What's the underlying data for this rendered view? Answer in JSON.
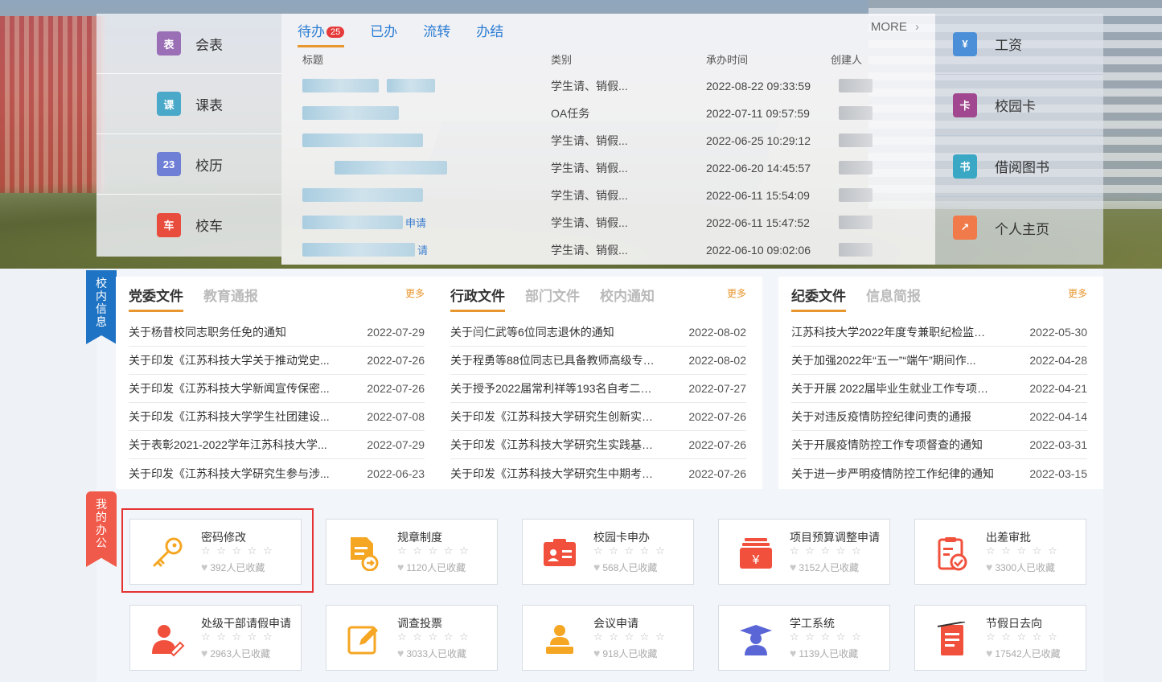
{
  "quick_left": [
    {
      "label": "会表",
      "icon": "report-icon",
      "color": "#9b6fb5",
      "glyph": "表"
    },
    {
      "label": "课表",
      "icon": "timetable-icon",
      "color": "#4aa8c9",
      "glyph": "课"
    },
    {
      "label": "校历",
      "icon": "calendar-icon",
      "color": "#6f7fd6",
      "glyph": "23"
    },
    {
      "label": "校车",
      "icon": "bus-icon",
      "color": "#e84c3d",
      "glyph": "车"
    }
  ],
  "todo": {
    "tabs": [
      {
        "label": "待办",
        "badge": "25"
      },
      {
        "label": "已办"
      },
      {
        "label": "流转"
      },
      {
        "label": "办结"
      }
    ],
    "more": "MORE",
    "more_arrow": "›",
    "headers": {
      "title": "标题",
      "type": "类别",
      "time": "承办时间",
      "creator": "创建人"
    },
    "rows": [
      {
        "title_suffix": "",
        "type": "学生请、销假...",
        "time": "2022-08-22 09:33:59"
      },
      {
        "title_suffix": "",
        "type": "OA任务",
        "time": "2022-07-11 09:57:59"
      },
      {
        "title_suffix": "",
        "type": "学生请、销假...",
        "time": "2022-06-25 10:29:12"
      },
      {
        "title_suffix": "",
        "type": "学生请、销假...",
        "time": "2022-06-20 14:45:57"
      },
      {
        "title_suffix": "",
        "type": "学生请、销假...",
        "time": "2022-06-11 15:54:09"
      },
      {
        "title_suffix": "申请",
        "type": "学生请、销假...",
        "time": "2022-06-11 15:47:52"
      },
      {
        "title_suffix": "请",
        "type": "学生请、销假...",
        "time": "2022-06-10 09:02:06"
      }
    ]
  },
  "quick_right": [
    {
      "label": "工资",
      "icon": "salary-icon",
      "color": "#4a8fd8",
      "glyph": "¥"
    },
    {
      "label": "校园卡",
      "icon": "campus-card-icon",
      "color": "#a0478f",
      "glyph": "卡"
    },
    {
      "label": "借阅图书",
      "icon": "book-icon",
      "color": "#3aa7c4",
      "glyph": "书"
    },
    {
      "label": "个人主页",
      "icon": "chart-line-icon",
      "color": "#f07a4a",
      "glyph": "↗"
    }
  ],
  "ribbons": {
    "info": "校内信息",
    "office": "我的办公"
  },
  "news": [
    {
      "tabs": [
        "党委文件",
        "教育通报"
      ],
      "more": "更多",
      "items": [
        {
          "title": "关于杨昔校同志职务任免的通知",
          "date": "2022-07-29"
        },
        {
          "title": "关于印发《江苏科技大学关于推动党史...",
          "date": "2022-07-26"
        },
        {
          "title": "关于印发《江苏科技大学新闻宣传保密...",
          "date": "2022-07-26"
        },
        {
          "title": "关于印发《江苏科技大学学生社团建设...",
          "date": "2022-07-08"
        },
        {
          "title": "关于表彰2021-2022学年江苏科技大学...",
          "date": "2022-07-29"
        },
        {
          "title": "关于印发《江苏科技大学研究生参与涉...",
          "date": "2022-06-23"
        }
      ]
    },
    {
      "tabs": [
        "行政文件",
        "部门文件",
        "校内通知"
      ],
      "more": "更多",
      "items": [
        {
          "title": "关于闫仁武等6位同志退休的通知",
          "date": "2022-08-02"
        },
        {
          "title": "关于程勇等88位同志已具备教师高级专业...",
          "date": "2022-08-02"
        },
        {
          "title": "关于授予2022届常利祥等193名自考二学...",
          "date": "2022-07-27"
        },
        {
          "title": "关于印发《江苏科技大学研究生创新实践...",
          "date": "2022-07-26"
        },
        {
          "title": "关于印发《江苏科技大学研究生实践基地...",
          "date": "2022-07-26"
        },
        {
          "title": "关于印发《江苏科技大学研究生中期考核...",
          "date": "2022-07-26"
        }
      ]
    },
    {
      "tabs": [
        "纪委文件",
        "信息简报"
      ],
      "more": "更多",
      "items": [
        {
          "title": "江苏科技大学2022年度专兼职纪检监察干...",
          "date": "2022-05-30"
        },
        {
          "title": "关于加强2022年“五一”“端午”期间作...",
          "date": "2022-04-28"
        },
        {
          "title": "关于开展 2022届毕业生就业工作专项督查...",
          "date": "2022-04-21"
        },
        {
          "title": "关于对违反疫情防控纪律问责的通报",
          "date": "2022-04-14"
        },
        {
          "title": "关于开展疫情防控工作专项督查的通知",
          "date": "2022-03-31"
        },
        {
          "title": "关于进一步严明疫情防控工作纪律的通知",
          "date": "2022-03-15"
        }
      ]
    }
  ],
  "apps": [
    {
      "name": "密码修改",
      "icon": "key-icon",
      "color": "#f5a623",
      "stars": "☆ ☆ ☆ ☆ ☆",
      "fav": "392人已收藏"
    },
    {
      "name": "规章制度",
      "icon": "document-arrow-icon",
      "color": "#f5a623",
      "stars": "☆ ☆ ☆ ☆ ☆",
      "fav": "1120人已收藏"
    },
    {
      "name": "校园卡申办",
      "icon": "id-card-icon",
      "color": "#f0503c",
      "stars": "☆ ☆ ☆ ☆ ☆",
      "fav": "568人已收藏"
    },
    {
      "name": "项目预算调整申请",
      "icon": "budget-icon",
      "color": "#f0503c",
      "stars": "☆ ☆ ☆ ☆ ☆",
      "fav": "3152人已收藏"
    },
    {
      "name": "出差审批",
      "icon": "clipboard-check-icon",
      "color": "#f0503c",
      "stars": "☆ ☆ ☆ ☆ ☆",
      "fav": "3300人已收藏"
    },
    {
      "name": "处级干部请假申请",
      "icon": "person-edit-icon",
      "color": "#f0503c",
      "stars": "☆ ☆ ☆ ☆ ☆",
      "fav": "2963人已收藏"
    },
    {
      "name": "调查投票",
      "icon": "survey-edit-icon",
      "color": "#f5a623",
      "stars": "☆ ☆ ☆ ☆ ☆",
      "fav": "3033人已收藏"
    },
    {
      "name": "会议申请",
      "icon": "meeting-icon",
      "color": "#f5a623",
      "stars": "☆ ☆ ☆ ☆ ☆",
      "fav": "918人已收藏"
    },
    {
      "name": "学工系统",
      "icon": "graduate-icon",
      "color": "#5a66d6",
      "stars": "☆ ☆ ☆ ☆ ☆",
      "fav": "1139人已收藏"
    },
    {
      "name": "节假日去向",
      "icon": "holiday-doc-icon",
      "color": "#f0503c",
      "stars": "☆ ☆ ☆ ☆ ☆",
      "fav": "17542人已收藏"
    }
  ]
}
